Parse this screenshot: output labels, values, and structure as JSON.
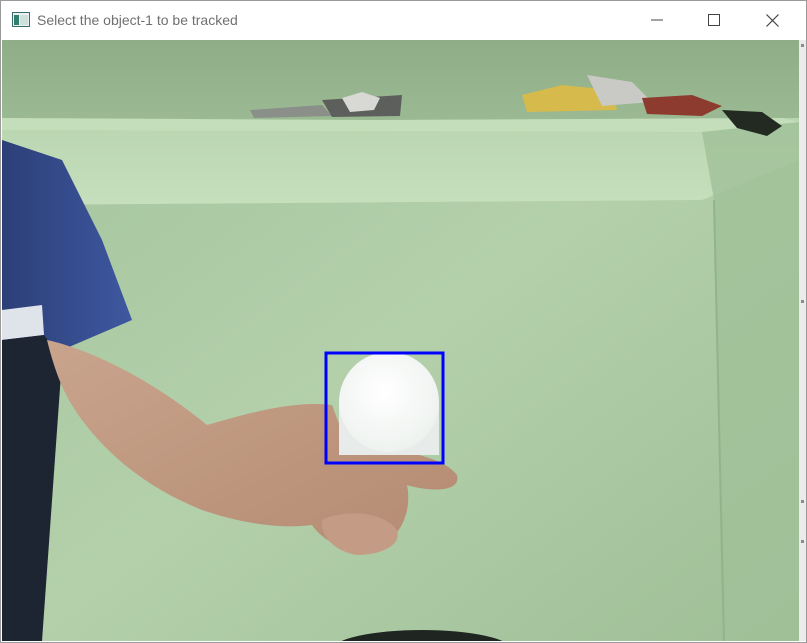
{
  "window": {
    "title": "Select the object-1 to be tracked"
  },
  "controls": {
    "minimize_icon": "minimize-icon",
    "maximize_icon": "maximize-icon",
    "close_icon": "close-icon"
  },
  "frame": {
    "selection_color": "#0000ff",
    "wall_color": "#a9c9a1"
  }
}
